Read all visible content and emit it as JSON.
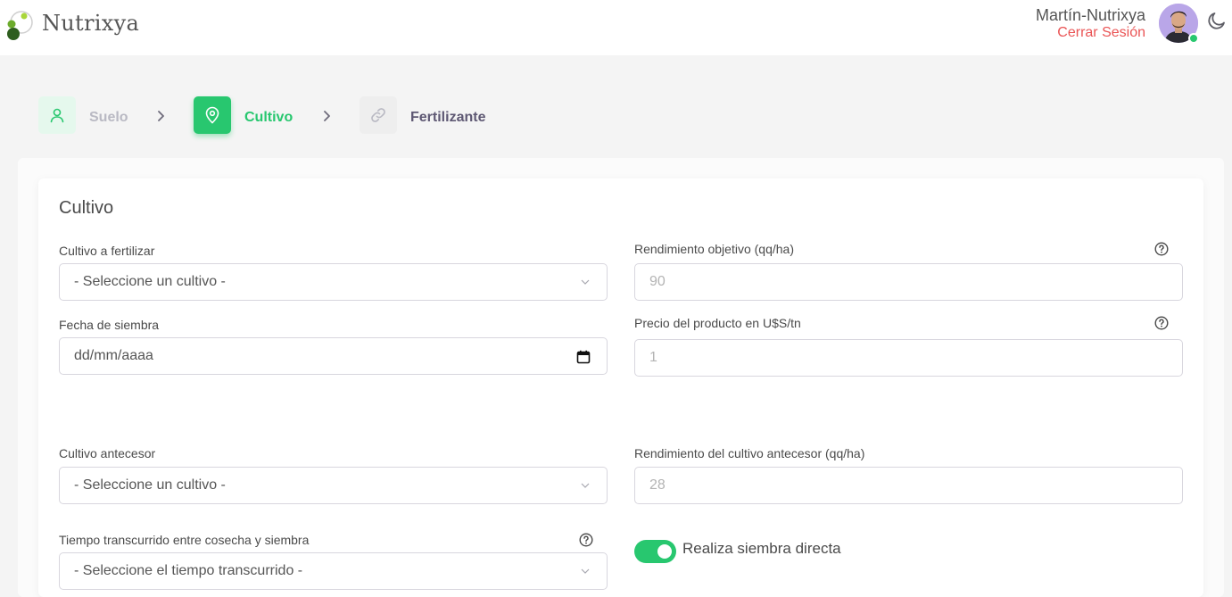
{
  "header": {
    "brand": "Nutrixya",
    "user_name": "Martín-Nutrixya",
    "logout_label": "Cerrar Sesión"
  },
  "stepper": {
    "steps": [
      {
        "label": "Suelo",
        "icon": "user-icon",
        "state": "completed"
      },
      {
        "label": "Cultivo",
        "icon": "map-pin-icon",
        "state": "active"
      },
      {
        "label": "Fertilizante",
        "icon": "link-icon",
        "state": "pending"
      }
    ]
  },
  "form": {
    "title": "Cultivo",
    "cultivo_a_fertilizar": {
      "label": "Cultivo a fertilizar",
      "value": "- Seleccione un cultivo -"
    },
    "rendimiento_objetivo": {
      "label": "Rendimiento objetivo (qq/ha)",
      "placeholder": "90"
    },
    "fecha_siembra": {
      "label": "Fecha de siembra",
      "value": "dd/mm/aaaa"
    },
    "precio_producto": {
      "label": "Precio del producto en U$S/tn",
      "placeholder": "1"
    },
    "cultivo_antecesor": {
      "label": "Cultivo antecesor",
      "value": "- Seleccione un cultivo -"
    },
    "rendimiento_antecesor": {
      "label": "Rendimiento del cultivo antecesor (qq/ha)",
      "placeholder": "28"
    },
    "tiempo_transcurrido": {
      "label": "Tiempo transcurrido entre cosecha y siembra",
      "value": "- Seleccione el tiempo transcurrido -"
    },
    "siembra_directa": {
      "label": "Realiza siembra directa",
      "checked": true
    }
  },
  "colors": {
    "accent": "#28c76f",
    "danger": "#ea5455",
    "accent_light": "#e5f8ed"
  }
}
